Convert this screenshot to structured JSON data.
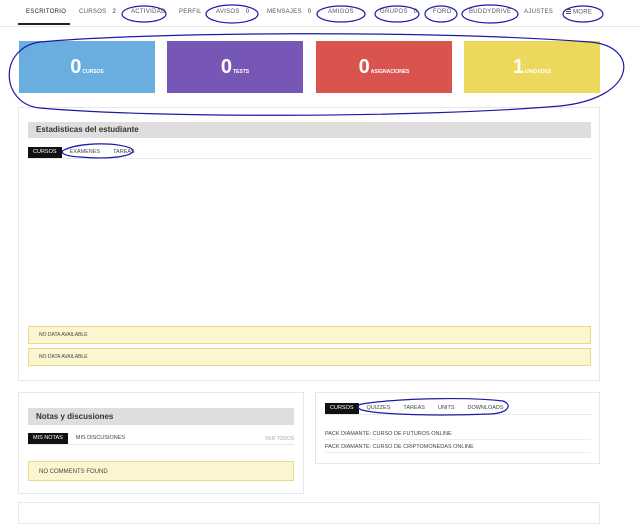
{
  "nav": {
    "items": [
      {
        "label": "Escritorio",
        "count": ""
      },
      {
        "label": "Cursos",
        "count": "2"
      },
      {
        "label": "Actividad",
        "count": ""
      },
      {
        "label": "Perfil",
        "count": ""
      },
      {
        "label": "Avisos",
        "count": "0"
      },
      {
        "label": "Mensajes",
        "count": "0"
      },
      {
        "label": "Amigos",
        "count": ""
      },
      {
        "label": "Grupos",
        "count": "0"
      },
      {
        "label": "Foro",
        "count": ""
      },
      {
        "label": "BuddyDrive",
        "count": ""
      },
      {
        "label": "Ajustes",
        "count": ""
      },
      {
        "label": "More",
        "count": ""
      }
    ],
    "active": "Escritorio"
  },
  "stats": [
    {
      "value": "0",
      "label": "Cursos",
      "color": "#6aaee0"
    },
    {
      "value": "0",
      "label": "Tests",
      "color": "#7757b5"
    },
    {
      "value": "0",
      "label": "Asignaciones",
      "color": "#d9534f"
    },
    {
      "value": "1",
      "label": "Unidades",
      "color": "#ecd85a"
    }
  ],
  "student_stats": {
    "title": "Estadisticas del estudiante",
    "tabs": [
      "Cursos",
      "Examenes",
      "Tareas"
    ],
    "notices": [
      "No data available",
      "No data available"
    ]
  },
  "notes": {
    "title": "Notas y discusiones",
    "tabs": [
      "Mis notas",
      "Mis discusiones"
    ],
    "view_all": "Ver todos",
    "empty": "No comments found"
  },
  "courses_panel": {
    "tabs": [
      "Cursos",
      "Quizzes",
      "Tareas",
      "Units",
      "Downloads"
    ],
    "items": [
      "Pack Diamante: Curso de Futuros Online",
      "Pack Diamante: Curso de Criptomonedas Online"
    ]
  },
  "colors": {
    "accent": "#111111",
    "notice_bg": "#fbf6cf",
    "annotation": "#1a1aa8"
  }
}
